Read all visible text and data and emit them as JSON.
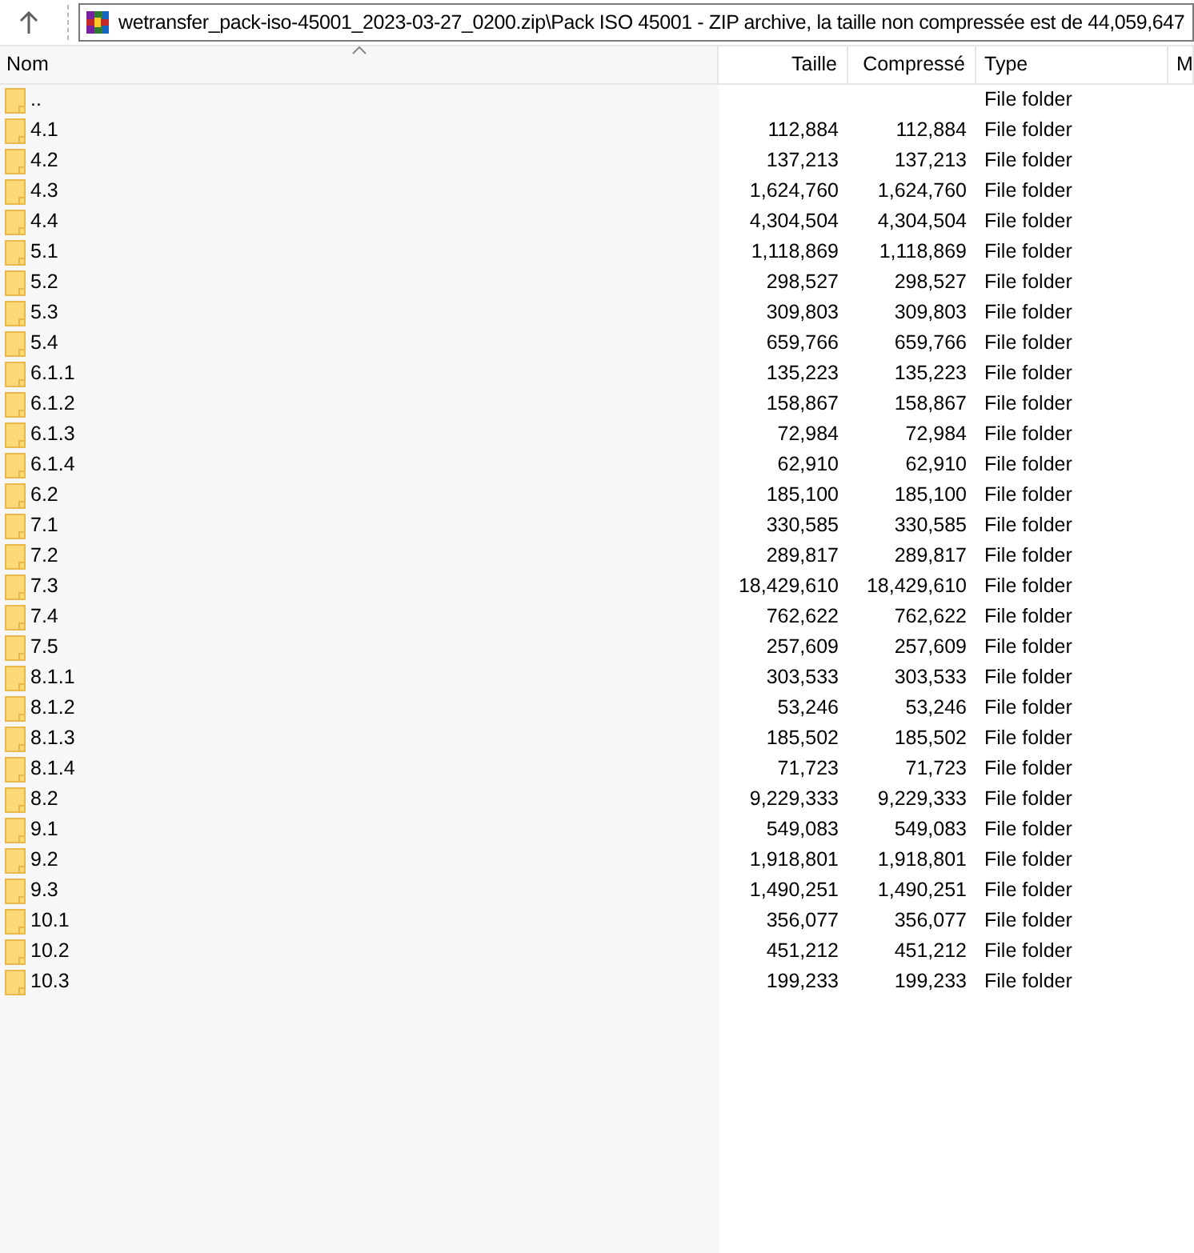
{
  "address_bar": {
    "path": "wetransfer_pack-iso-45001_2023-03-27_0200.zip\\Pack ISO 45001 - ZIP archive, la taille non compressée est de 44,059,647"
  },
  "table": {
    "columns": [
      "Nom",
      "Taille",
      "Compressé",
      "Type",
      "M"
    ],
    "rows": [
      {
        "name": "..",
        "type": "File folder"
      },
      {
        "name": "4.1",
        "size": "112,884",
        "compressed": "112,884",
        "type": "File folder"
      },
      {
        "name": "4.2",
        "size": "137,213",
        "compressed": "137,213",
        "type": "File folder"
      },
      {
        "name": "4.3",
        "size": "1,624,760",
        "compressed": "1,624,760",
        "type": "File folder"
      },
      {
        "name": "4.4",
        "size": "4,304,504",
        "compressed": "4,304,504",
        "type": "File folder"
      },
      {
        "name": "5.1",
        "size": "1,118,869",
        "compressed": "1,118,869",
        "type": "File folder"
      },
      {
        "name": "5.2",
        "size": "298,527",
        "compressed": "298,527",
        "type": "File folder"
      },
      {
        "name": "5.3",
        "size": "309,803",
        "compressed": "309,803",
        "type": "File folder"
      },
      {
        "name": "5.4",
        "size": "659,766",
        "compressed": "659,766",
        "type": "File folder"
      },
      {
        "name": "6.1.1",
        "size": "135,223",
        "compressed": "135,223",
        "type": "File folder"
      },
      {
        "name": "6.1.2",
        "size": "158,867",
        "compressed": "158,867",
        "type": "File folder"
      },
      {
        "name": "6.1.3",
        "size": "72,984",
        "compressed": "72,984",
        "type": "File folder"
      },
      {
        "name": "6.1.4",
        "size": "62,910",
        "compressed": "62,910",
        "type": "File folder"
      },
      {
        "name": "6.2",
        "size": "185,100",
        "compressed": "185,100",
        "type": "File folder"
      },
      {
        "name": "7.1",
        "size": "330,585",
        "compressed": "330,585",
        "type": "File folder"
      },
      {
        "name": "7.2",
        "size": "289,817",
        "compressed": "289,817",
        "type": "File folder"
      },
      {
        "name": "7.3",
        "size": "18,429,610",
        "compressed": "18,429,610",
        "type": "File folder"
      },
      {
        "name": "7.4",
        "size": "762,622",
        "compressed": "762,622",
        "type": "File folder"
      },
      {
        "name": "7.5",
        "size": "257,609",
        "compressed": "257,609",
        "type": "File folder"
      },
      {
        "name": "8.1.1",
        "size": "303,533",
        "compressed": "303,533",
        "type": "File folder"
      },
      {
        "name": "8.1.2",
        "size": "53,246",
        "compressed": "53,246",
        "type": "File folder"
      },
      {
        "name": "8.1.3",
        "size": "185,502",
        "compressed": "185,502",
        "type": "File folder"
      },
      {
        "name": "8.1.4",
        "size": "71,723",
        "compressed": "71,723",
        "type": "File folder"
      },
      {
        "name": "8.2",
        "size": "9,229,333",
        "compressed": "9,229,333",
        "type": "File folder"
      },
      {
        "name": "9.1",
        "size": "549,083",
        "compressed": "549,083",
        "type": "File folder"
      },
      {
        "name": "9.2",
        "size": "1,918,801",
        "compressed": "1,918,801",
        "type": "File folder"
      },
      {
        "name": "9.3",
        "size": "1,490,251",
        "compressed": "1,490,251",
        "type": "File folder"
      },
      {
        "name": "10.1",
        "size": "356,077",
        "compressed": "356,077",
        "type": "File folder"
      },
      {
        "name": "10.2",
        "size": "451,212",
        "compressed": "451,212",
        "type": "File folder"
      },
      {
        "name": "10.3",
        "size": "199,233",
        "compressed": "199,233",
        "type": "File folder"
      }
    ]
  }
}
